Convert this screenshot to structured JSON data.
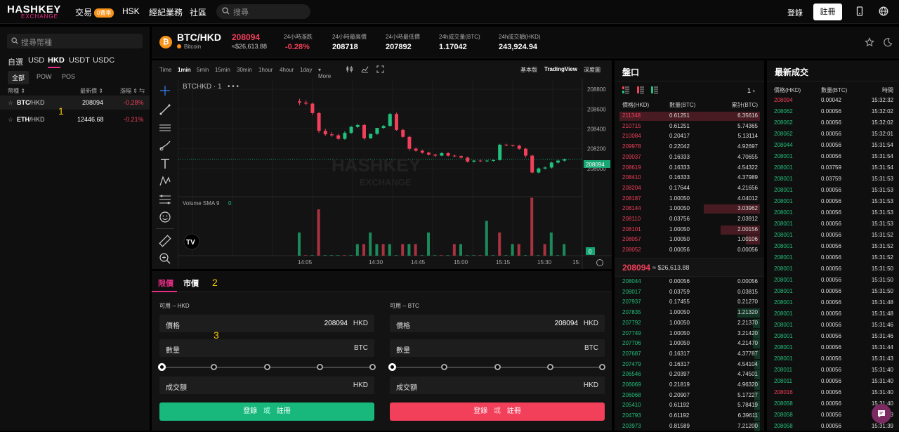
{
  "topbar": {
    "logo_line1": "HASHKEY",
    "logo_line2": "EXCHANGE",
    "nav_trade": "交易",
    "nav_trade_badge": "0費率",
    "nav_hsk": "HSK",
    "nav_broker": "經紀業務",
    "nav_community": "社區",
    "search_placeholder": "搜尋",
    "login": "登錄",
    "register": "註冊"
  },
  "sidebar": {
    "search_placeholder": "搜尋幣種",
    "quote_tabs": [
      "自選",
      "USD",
      "HKD",
      "USDT",
      "USDC"
    ],
    "active_quote_tab": "HKD",
    "sub_tabs": [
      "全部",
      "POW",
      "POS"
    ],
    "col_coin": "幣種",
    "col_price": "最新價",
    "col_change": "漲幅",
    "rows": [
      {
        "base": "BTC",
        "quote": "/HKD",
        "price": "208094",
        "change": "-0.28%"
      },
      {
        "base": "ETH",
        "quote": "/HKD",
        "price": "12446.68",
        "change": "-0.21%"
      }
    ]
  },
  "header": {
    "pair": "BTC/HKD",
    "coin": "Bitcoin",
    "price": "208094",
    "price_usd": "≈$26,613.88",
    "stats": [
      {
        "label": "24小時漲跌",
        "value": "-0.28%"
      },
      {
        "label": "24小時最高價",
        "value": "208718"
      },
      {
        "label": "24小時最低價",
        "value": "207892"
      },
      {
        "label": "24h成交量(BTC)",
        "value": "1.17042"
      },
      {
        "label": "24h成交額(HKD)",
        "value": "243,924.94"
      }
    ]
  },
  "chart_toolbar": {
    "intervals": [
      "Time",
      "1min",
      "5min",
      "15min",
      "30min",
      "1hour",
      "4hour",
      "1day",
      "More"
    ],
    "active_interval": "1min",
    "views": [
      "基本版",
      "TradingView",
      "深度圖"
    ],
    "active_view": "TradingView"
  },
  "chart_labels": {
    "symbol": "BTCHKD · 1",
    "volume_label": "Volume SMA 9",
    "volume_value": "0",
    "last_price_tag": "208094",
    "volume_tag": "0",
    "watermark1": "HASHKEY",
    "watermark2": "EXCHANGE"
  },
  "chart_data": {
    "type": "candlestick",
    "y_ticks": [
      208800,
      208600,
      208400,
      208200,
      208000
    ],
    "x_ticks": [
      "14:05",
      "14:30",
      "14:45",
      "15:00",
      "15:15",
      "15:30",
      "15:"
    ],
    "last_price": 208094,
    "candles": [
      {
        "o": 208678,
        "h": 208705,
        "c": 208665,
        "l": 208640,
        "up": false
      },
      {
        "o": 208665,
        "h": 208690,
        "c": 208655,
        "l": 208640,
        "up": false
      },
      {
        "o": 208655,
        "h": 208665,
        "c": 208560,
        "l": 208540,
        "up": false
      },
      {
        "o": 208560,
        "h": 208570,
        "c": 208380,
        "l": 208360,
        "up": false
      },
      {
        "o": 208380,
        "h": 208400,
        "c": 208345,
        "l": 208330,
        "up": false
      },
      {
        "o": 208345,
        "h": 208370,
        "c": 208335,
        "l": 208320,
        "up": false
      },
      {
        "o": 208335,
        "h": 208350,
        "c": 208300,
        "l": 208290,
        "up": false
      },
      {
        "o": 208300,
        "h": 208375,
        "c": 208360,
        "l": 208290,
        "up": true
      },
      {
        "o": 208360,
        "h": 208430,
        "c": 208420,
        "l": 208350,
        "up": true
      },
      {
        "o": 208420,
        "h": 208450,
        "c": 208440,
        "l": 208410,
        "up": true
      },
      {
        "o": 208440,
        "h": 208450,
        "c": 208305,
        "l": 208290,
        "up": false
      },
      {
        "o": 208305,
        "h": 208320,
        "c": 208350,
        "l": 208300,
        "up": true
      },
      {
        "o": 208350,
        "h": 208370,
        "c": 208410,
        "l": 208340,
        "up": true
      },
      {
        "o": 208410,
        "h": 208440,
        "c": 208430,
        "l": 208400,
        "up": true
      },
      {
        "o": 208430,
        "h": 208560,
        "c": 208550,
        "l": 208420,
        "up": true
      },
      {
        "o": 208550,
        "h": 208565,
        "c": 208390,
        "l": 208380,
        "up": false
      },
      {
        "o": 208390,
        "h": 208400,
        "c": 208320,
        "l": 208310,
        "up": false
      },
      {
        "o": 208320,
        "h": 208330,
        "c": 208200,
        "l": 208180,
        "up": false
      },
      {
        "o": 208200,
        "h": 208215,
        "c": 208180,
        "l": 208170,
        "up": false
      },
      {
        "o": 208180,
        "h": 208190,
        "c": 208160,
        "l": 208150,
        "up": false
      },
      {
        "o": 208160,
        "h": 208170,
        "c": 208140,
        "l": 208130,
        "up": false
      },
      {
        "o": 208140,
        "h": 208150,
        "c": 208130,
        "l": 208115,
        "up": false
      },
      {
        "o": 208130,
        "h": 208165,
        "c": 208155,
        "l": 208125,
        "up": true
      },
      {
        "o": 208155,
        "h": 208165,
        "c": 208130,
        "l": 208120,
        "up": false
      },
      {
        "o": 208130,
        "h": 208140,
        "c": 208125,
        "l": 208115,
        "up": false
      },
      {
        "o": 208125,
        "h": 208135,
        "c": 208110,
        "l": 208100,
        "up": false
      },
      {
        "o": 208110,
        "h": 208120,
        "c": 208070,
        "l": 208060,
        "up": false
      },
      {
        "o": 208070,
        "h": 208085,
        "c": 208080,
        "l": 208060,
        "up": true
      },
      {
        "o": 208080,
        "h": 208090,
        "c": 208075,
        "l": 208065,
        "up": false
      },
      {
        "o": 208075,
        "h": 208085,
        "c": 208080,
        "l": 208065,
        "up": true
      },
      {
        "o": 208080,
        "h": 208090,
        "c": 208085,
        "l": 208070,
        "up": true
      },
      {
        "o": 208085,
        "h": 208250,
        "c": 208240,
        "l": 208080,
        "up": true
      },
      {
        "o": 208240,
        "h": 208250,
        "c": 208235,
        "l": 208225,
        "up": false
      },
      {
        "o": 208235,
        "h": 208240,
        "c": 208230,
        "l": 208220,
        "up": false
      },
      {
        "o": 208230,
        "h": 208240,
        "c": 208200,
        "l": 208190,
        "up": false
      },
      {
        "o": 208200,
        "h": 208210,
        "c": 208130,
        "l": 208110,
        "up": false
      },
      {
        "o": 208130,
        "h": 208140,
        "c": 207960,
        "l": 207950,
        "up": false
      },
      {
        "o": 207960,
        "h": 208010,
        "c": 208000,
        "l": 207950,
        "up": true
      },
      {
        "o": 208000,
        "h": 208020,
        "c": 208010,
        "l": 207990,
        "up": true
      },
      {
        "o": 208010,
        "h": 208070,
        "c": 208060,
        "l": 208000,
        "up": true
      },
      {
        "o": 208060,
        "h": 208090,
        "c": 208080,
        "l": 208050,
        "up": true
      },
      {
        "o": 208080,
        "h": 208100,
        "c": 208094,
        "l": 208070,
        "up": true
      }
    ],
    "volumes": [
      0.1,
      0,
      0,
      0.2,
      0,
      0,
      0,
      0,
      0,
      0.05,
      0.05,
      0.1,
      0.05,
      0.05,
      0.05,
      0,
      0.05,
      0.05,
      0.05,
      0,
      0.1,
      0,
      0,
      0,
      0.05,
      0.05,
      0,
      0,
      0,
      0.15,
      0,
      0.1,
      0,
      0.05,
      0.05,
      0,
      0.25,
      0,
      0.05,
      0.1,
      0,
      0.05
    ],
    "volume_colors_up": [
      true,
      false,
      true,
      false,
      true,
      true,
      true,
      false,
      true,
      true,
      false,
      true,
      true,
      false,
      true,
      true,
      false,
      true,
      false,
      true,
      true,
      true,
      false,
      true,
      false,
      true,
      true,
      true,
      false,
      true,
      true,
      false,
      true,
      true,
      false,
      true,
      false,
      true,
      false,
      true,
      true,
      true
    ]
  },
  "order": {
    "tabs": [
      "限價",
      "市價"
    ],
    "active_tab": "限價",
    "buy": {
      "available": "可用 -- HKD",
      "price_label": "價格",
      "price_value": "208094",
      "price_unit": "HKD",
      "qty_label": "數量",
      "qty_unit": "BTC",
      "total_label": "成交額",
      "total_unit": "HKD",
      "btn_login": "登錄",
      "btn_or": "或",
      "btn_register": "註冊"
    },
    "sell": {
      "available": "可用 -- BTC",
      "price_label": "價格",
      "price_value": "208094",
      "price_unit": "HKD",
      "qty_label": "數量",
      "qty_unit": "BTC",
      "total_label": "成交額",
      "total_unit": "HKD",
      "btn_login": "登錄",
      "btn_or": "或",
      "btn_register": "註冊"
    }
  },
  "orderbook": {
    "title": "盤口",
    "precision": "1",
    "col_price": "價格(HKD)",
    "col_qty": "數量(BTC)",
    "col_total": "累計(BTC)",
    "asks": [
      {
        "price": "211348",
        "qty": "0.61251",
        "total": "6.35616",
        "depth": 1.0
      },
      {
        "price": "210715",
        "qty": "0.61251",
        "total": "5.74365",
        "depth": 0.0
      },
      {
        "price": "210084",
        "qty": "0.20417",
        "total": "5.13114",
        "depth": 0.0
      },
      {
        "price": "209978",
        "qty": "0.22042",
        "total": "4.92697",
        "depth": 0.0
      },
      {
        "price": "209037",
        "qty": "0.16333",
        "total": "4.70655",
        "depth": 0.0
      },
      {
        "price": "208619",
        "qty": "0.16333",
        "total": "4.54322",
        "depth": 0.0
      },
      {
        "price": "208410",
        "qty": "0.16333",
        "total": "4.37989",
        "depth": 0.0
      },
      {
        "price": "208204",
        "qty": "0.17644",
        "total": "4.21656",
        "depth": 0.0
      },
      {
        "price": "208187",
        "qty": "1.00050",
        "total": "4.04012",
        "depth": 0.0
      },
      {
        "price": "208144",
        "qty": "1.00050",
        "total": "3.03962",
        "depth": 0.4
      },
      {
        "price": "208110",
        "qty": "0.03756",
        "total": "2.03912",
        "depth": 0.0
      },
      {
        "price": "208101",
        "qty": "1.00050",
        "total": "2.00156",
        "depth": 0.28
      },
      {
        "price": "208057",
        "qty": "1.00050",
        "total": "1.00106",
        "depth": 0.1
      },
      {
        "price": "208052",
        "qty": "0.00056",
        "total": "0.00056",
        "depth": 0.0
      }
    ],
    "mid_price": "208094",
    "mid_usd": "≈ $26,613.88",
    "bids": [
      {
        "price": "208044",
        "qty": "0.00056",
        "total": "0.00056",
        "depth": 0.0
      },
      {
        "price": "208017",
        "qty": "0.03759",
        "total": "0.03815",
        "depth": 0.0
      },
      {
        "price": "207937",
        "qty": "0.17455",
        "total": "0.21270",
        "depth": 0.0
      },
      {
        "price": "207835",
        "qty": "1.00050",
        "total": "1.21320",
        "depth": 0.16
      },
      {
        "price": "207792",
        "qty": "1.00050",
        "total": "2.21370",
        "depth": 0.05
      },
      {
        "price": "207749",
        "qty": "1.00050",
        "total": "3.21420",
        "depth": 0.05
      },
      {
        "price": "207706",
        "qty": "1.00050",
        "total": "4.21470",
        "depth": 0.05
      },
      {
        "price": "207687",
        "qty": "0.16317",
        "total": "4.37787",
        "depth": 0.04
      },
      {
        "price": "207479",
        "qty": "0.16317",
        "total": "4.54104",
        "depth": 0.04
      },
      {
        "price": "206546",
        "qty": "0.20397",
        "total": "4.74501",
        "depth": 0.04
      },
      {
        "price": "206069",
        "qty": "0.21819",
        "total": "4.96320",
        "depth": 0.04
      },
      {
        "price": "206068",
        "qty": "0.20907",
        "total": "5.17227",
        "depth": 0.04
      },
      {
        "price": "205410",
        "qty": "0.61192",
        "total": "5.78419",
        "depth": 0.04
      },
      {
        "price": "204793",
        "qty": "0.61192",
        "total": "6.39611",
        "depth": 0.04
      },
      {
        "price": "203973",
        "qty": "0.81589",
        "total": "7.21200",
        "depth": 0.04
      }
    ]
  },
  "trades": {
    "title": "最新成交",
    "col_price": "價格(HKD)",
    "col_qty": "數量(BTC)",
    "col_time": "時間",
    "rows": [
      {
        "price": "208094",
        "qty": "0.00042",
        "time": "15:32:32",
        "side": "sell"
      },
      {
        "price": "208062",
        "qty": "0.00056",
        "time": "15:32:02",
        "side": "buy"
      },
      {
        "price": "208062",
        "qty": "0.00056",
        "time": "15:32:02",
        "side": "buy"
      },
      {
        "price": "208062",
        "qty": "0.00056",
        "time": "15:32:01",
        "side": "buy"
      },
      {
        "price": "208044",
        "qty": "0.00056",
        "time": "15:31:54",
        "side": "buy"
      },
      {
        "price": "208001",
        "qty": "0.00056",
        "time": "15:31:54",
        "side": "buy"
      },
      {
        "price": "208001",
        "qty": "0.03759",
        "time": "15:31:54",
        "side": "buy"
      },
      {
        "price": "208001",
        "qty": "0.03759",
        "time": "15:31:53",
        "side": "buy"
      },
      {
        "price": "208001",
        "qty": "0.00056",
        "time": "15:31:53",
        "side": "buy"
      },
      {
        "price": "208001",
        "qty": "0.00056",
        "time": "15:31:53",
        "side": "buy"
      },
      {
        "price": "208001",
        "qty": "0.00056",
        "time": "15:31:53",
        "side": "buy"
      },
      {
        "price": "208001",
        "qty": "0.00056",
        "time": "15:31:53",
        "side": "buy"
      },
      {
        "price": "208001",
        "qty": "0.00056",
        "time": "15:31:52",
        "side": "buy"
      },
      {
        "price": "208001",
        "qty": "0.00056",
        "time": "15:31:52",
        "side": "buy"
      },
      {
        "price": "208001",
        "qty": "0.00056",
        "time": "15:31:52",
        "side": "buy"
      },
      {
        "price": "208001",
        "qty": "0.00056",
        "time": "15:31:50",
        "side": "buy"
      },
      {
        "price": "208001",
        "qty": "0.00056",
        "time": "15:31:50",
        "side": "buy"
      },
      {
        "price": "208001",
        "qty": "0.00056",
        "time": "15:31:50",
        "side": "buy"
      },
      {
        "price": "208001",
        "qty": "0.00056",
        "time": "15:31:48",
        "side": "buy"
      },
      {
        "price": "208001",
        "qty": "0.00056",
        "time": "15:31:48",
        "side": "buy"
      },
      {
        "price": "208001",
        "qty": "0.00056",
        "time": "15:31:46",
        "side": "buy"
      },
      {
        "price": "208001",
        "qty": "0.00056",
        "time": "15:31:46",
        "side": "buy"
      },
      {
        "price": "208001",
        "qty": "0.00056",
        "time": "15:31:44",
        "side": "buy"
      },
      {
        "price": "208001",
        "qty": "0.00056",
        "time": "15:31:43",
        "side": "buy"
      },
      {
        "price": "208011",
        "qty": "0.00056",
        "time": "15:31:40",
        "side": "buy"
      },
      {
        "price": "208011",
        "qty": "0.00056",
        "time": "15:31:40",
        "side": "buy"
      },
      {
        "price": "208016",
        "qty": "0.00056",
        "time": "15:31:40",
        "side": "sell"
      },
      {
        "price": "208058",
        "qty": "0.00056",
        "time": "15:31:40",
        "side": "buy"
      },
      {
        "price": "208058",
        "qty": "0.00056",
        "time": "15:31:39",
        "side": "buy"
      },
      {
        "price": "208058",
        "qty": "0.00056",
        "time": "15:31:39",
        "side": "buy"
      }
    ]
  },
  "annotations": [
    "1",
    "2",
    "3"
  ],
  "colors": {
    "accent": "#e62d86",
    "up": "#22c07d",
    "down": "#f23f5a",
    "btc": "#f7931a"
  }
}
